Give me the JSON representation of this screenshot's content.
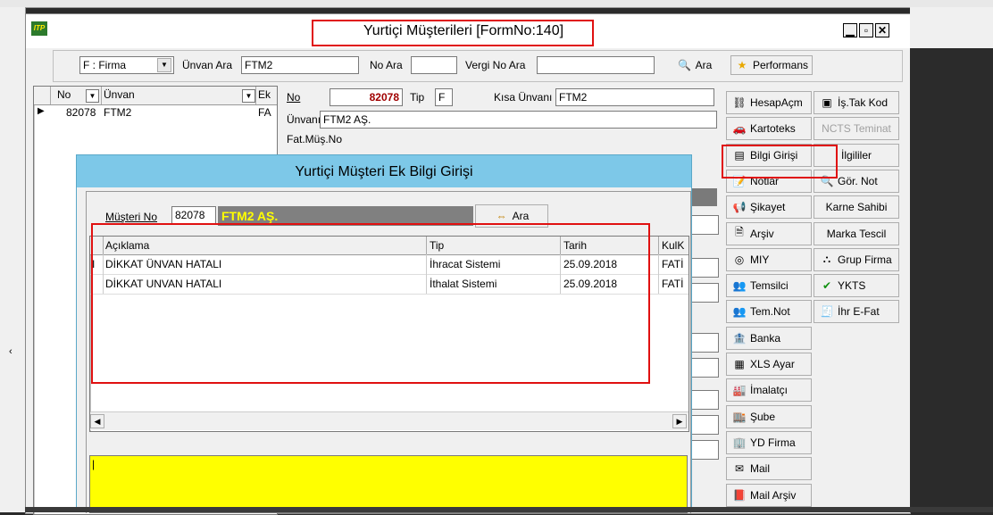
{
  "main_window": {
    "title": "Yurtiçi Müşterileri [FormNo:140]",
    "logo_text": "ITP"
  },
  "search_bar": {
    "filter_value": "F : Firma",
    "unvan_label": "Ünvan Ara",
    "unvan_value": "FTM2",
    "no_label": "No Ara",
    "no_value": "",
    "vergi_label": "Vergi No Ara",
    "vergi_value": "",
    "search_button": "Ara",
    "performance_button": "Performans"
  },
  "left_grid": {
    "col_no": "No",
    "col_unvan": "Ünvan",
    "col_ek": "Ek",
    "row_no": "82078",
    "row_unvan": "FTM2",
    "row_ek": "FA"
  },
  "detail": {
    "no_label": "No",
    "no_value": "82078",
    "tip_label": "Tip",
    "tip_value": "F",
    "kisa_label": "Kısa Ünvanı",
    "kisa_value": "FTM2",
    "unvan_label": "Ünvanı",
    "unvan_value": "FTM2 AŞ.",
    "fatmus_label": "Fat.Müş.No"
  },
  "side_buttons_a": [
    {
      "label": "HesapAçm",
      "icon": "link-icon"
    },
    {
      "label": "Kartoteks",
      "icon": "car-icon"
    },
    {
      "label": "Bilgi Girişi",
      "icon": "form-icon"
    },
    {
      "label": "Notlar",
      "icon": "note-icon"
    },
    {
      "label": "Şikayet",
      "icon": "complaint-icon"
    },
    {
      "label": "Arşiv",
      "icon": "archive-icon"
    },
    {
      "label": "MIY",
      "icon": "globe-icon"
    },
    {
      "label": "Temsilci",
      "icon": "people-icon"
    },
    {
      "label": "Tem.Not",
      "icon": "people-note-icon"
    },
    {
      "label": "Banka",
      "icon": "bank-icon"
    },
    {
      "label": "XLS Ayar",
      "icon": "excel-icon"
    },
    {
      "label": "İmalatçı",
      "icon": "factory-icon"
    },
    {
      "label": "Şube",
      "icon": "branch-icon"
    },
    {
      "label": "YD Firma",
      "icon": "foreign-company-icon"
    },
    {
      "label": "Mail",
      "icon": "mail-icon"
    },
    {
      "label": "Mail Arşiv",
      "icon": "mail-archive-icon"
    }
  ],
  "side_buttons_b": [
    {
      "label": "İş.Tak Kod",
      "icon": "tracking-icon"
    },
    {
      "label": "NCTS Teminat",
      "icon": "",
      "disabled": true
    },
    {
      "label": "İlgililer",
      "icon": ""
    },
    {
      "label": "Gör. Not",
      "icon": "view-note-icon"
    },
    {
      "label": "Karne Sahibi",
      "icon": ""
    },
    {
      "label": "Marka Tescil",
      "icon": ""
    },
    {
      "label": "Grup Firma",
      "icon": "group-icon"
    },
    {
      "label": "YKTS",
      "icon": "check-icon"
    },
    {
      "label": "İhr E-Fat",
      "icon": "invoice-icon"
    }
  ],
  "dialog": {
    "title": "Yurtiçi Müşteri Ek Bilgi Girişi",
    "musteri_label": "Müşteri No",
    "musteri_no": "82078",
    "musteri_name": "FTM2 AŞ.",
    "ara_button": "Ara",
    "columns": [
      "Açıklama",
      "Tip",
      "Tarih",
      "KulK"
    ],
    "rows": [
      {
        "marker": "I",
        "aciklama": "DİKKAT ÜNVAN HATALI",
        "tip": "İhracat Sistemi",
        "tarih": "25.09.2018",
        "kul": "FATİ"
      },
      {
        "marker": "",
        "aciklama": "DİKKAT UNVAN HATALI",
        "tip": "İthalat Sistemi",
        "tarih": "25.09.2018",
        "kul": "FATİ"
      }
    ],
    "memo_text": "|"
  },
  "colors": {
    "dialog_title_bg": "#7dc8e8",
    "highlight_red": "#e01010",
    "memo_yellow": "#ffff00",
    "name_field_bg": "#808080",
    "name_field_fg": "#ffff00"
  }
}
